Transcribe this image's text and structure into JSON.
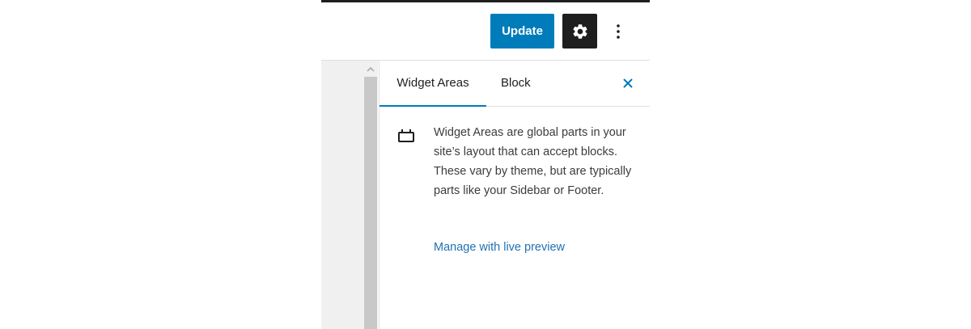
{
  "header": {
    "update_label": "Update",
    "settings_icon": "gear-icon",
    "more_icon": "vertical-ellipsis-icon",
    "accent_color": "#007cba"
  },
  "sidebar": {
    "tabs": [
      {
        "label": "Widget Areas",
        "active": true
      },
      {
        "label": "Block",
        "active": false
      }
    ],
    "close_icon": "close-icon",
    "panel": {
      "icon": "widget-area-icon",
      "description": "Widget Areas are global parts in your site’s layout that can accept blocks. These vary by theme, but are typically parts like your Sidebar or Footer.",
      "link_label": "Manage with live preview",
      "link_color": "#2271b1"
    }
  }
}
